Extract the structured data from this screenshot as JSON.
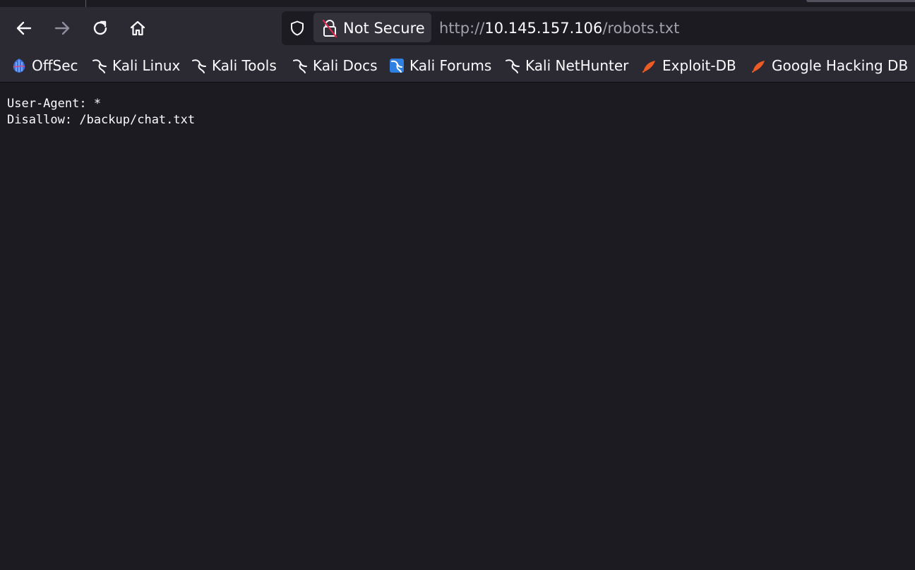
{
  "toolbar": {
    "back_icon": "arrow-left-icon",
    "forward_icon": "arrow-right-icon",
    "reload_icon": "reload-icon",
    "home_icon": "home-icon"
  },
  "urlbar": {
    "security_label": "Not Secure",
    "url_scheme": "http://",
    "url_host": "10.145.157.106",
    "url_path": "/robots.txt"
  },
  "bookmarks": [
    {
      "label": "OffSec",
      "icon": "offsec-icon"
    },
    {
      "label": "Kali Linux",
      "icon": "kali-dragon-icon"
    },
    {
      "label": "Kali Tools",
      "icon": "kali-dragon-icon"
    },
    {
      "label": "Kali Docs",
      "icon": "kali-dragon-icon"
    },
    {
      "label": "Kali Forums",
      "icon": "kali-forums-icon"
    },
    {
      "label": "Kali NetHunter",
      "icon": "kali-dragon-icon"
    },
    {
      "label": "Exploit-DB",
      "icon": "exploit-db-icon"
    },
    {
      "label": "Google Hacking DB",
      "icon": "exploit-db-icon"
    }
  ],
  "document": {
    "line1": "User-Agent: *",
    "line2": "Disallow: /backup/chat.txt"
  },
  "colors": {
    "chrome_bg": "#2b2a33",
    "content_bg": "#1c1b22",
    "text": "#fbfbfe",
    "dim_text": "#a2a1aa",
    "insecure_red": "#e22850",
    "exploit_orange": "#ec5b24",
    "offsec_blue": "#3c6fd8"
  }
}
